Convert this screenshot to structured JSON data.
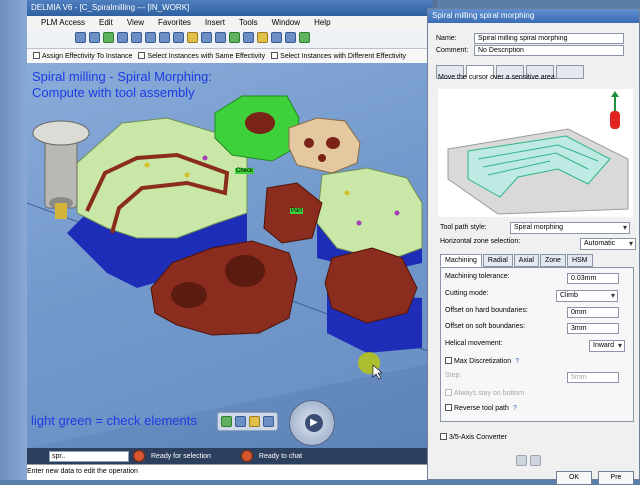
{
  "window": {
    "title": "DELMIA V6 - [C_Spiralmilling --- [IN_WORK]"
  },
  "menu": [
    "PLM Access",
    "Edit",
    "View",
    "Favorites",
    "Insert",
    "Tools",
    "Window",
    "Help"
  ],
  "effectivity": {
    "assign": "Assign Effectivity To Instance",
    "select_same": "Select Instances with Same Effectivity",
    "select_different": "Select Instances with Different Effectivity"
  },
  "viewport": {
    "title_line1": "Spiral milling - Spiral Morphing:",
    "title_line2": "Compute with tool assembly",
    "legend": "light green = check elements",
    "labels": {
      "check": "Check",
      "part": "Part"
    }
  },
  "statusbar": {
    "input_value": "spr..",
    "status1": "Ready for selection",
    "status2": "Ready to chat"
  },
  "prompt": "Enter new data to edit the operation",
  "dialog": {
    "title": "Spiral milling spiral morphing",
    "name_label": "Name:",
    "name_value": "Spiral milling spiral morphing",
    "comment_label": "Comment:",
    "comment_value": "No Description",
    "hint": "Move the cursor over a sensitive area.",
    "tool_path_style_label": "Tool path style:",
    "tool_path_style_value": "Spiral morphing",
    "horizontal_zone_label": "Horizontal zone selection:",
    "horizontal_zone_value": "Automatic",
    "tabs": [
      "Machining",
      "Radial",
      "Axial",
      "Zone",
      "HSM"
    ],
    "params": {
      "tolerance_label": "Machining tolerance:",
      "tolerance_value": "0.03mm",
      "cutting_mode_label": "Cutting mode:",
      "cutting_mode_value": "Climb",
      "hard_label": "Offset on hard boundaries:",
      "hard_value": "0mm",
      "soft_label": "Offset on soft boundaries:",
      "soft_value": "3mm",
      "helical_label": "Helical movement:",
      "helical_value": "Inward",
      "max_disc_label": "Max Discretization",
      "step_label": "Step:",
      "step_value": "5mm",
      "always_stay_label": "Always stay on bottom",
      "reverse_label": "Reverse tool path"
    },
    "converter_label": "3/5-Axis Converter",
    "ok_label": "OK",
    "preview_label": "Pre"
  },
  "colors": {
    "blue_text": "#1e3ce0",
    "part_brown": "#8a2c1e",
    "check_green": "#c9e7a6",
    "bright_green": "#3fd13b"
  }
}
